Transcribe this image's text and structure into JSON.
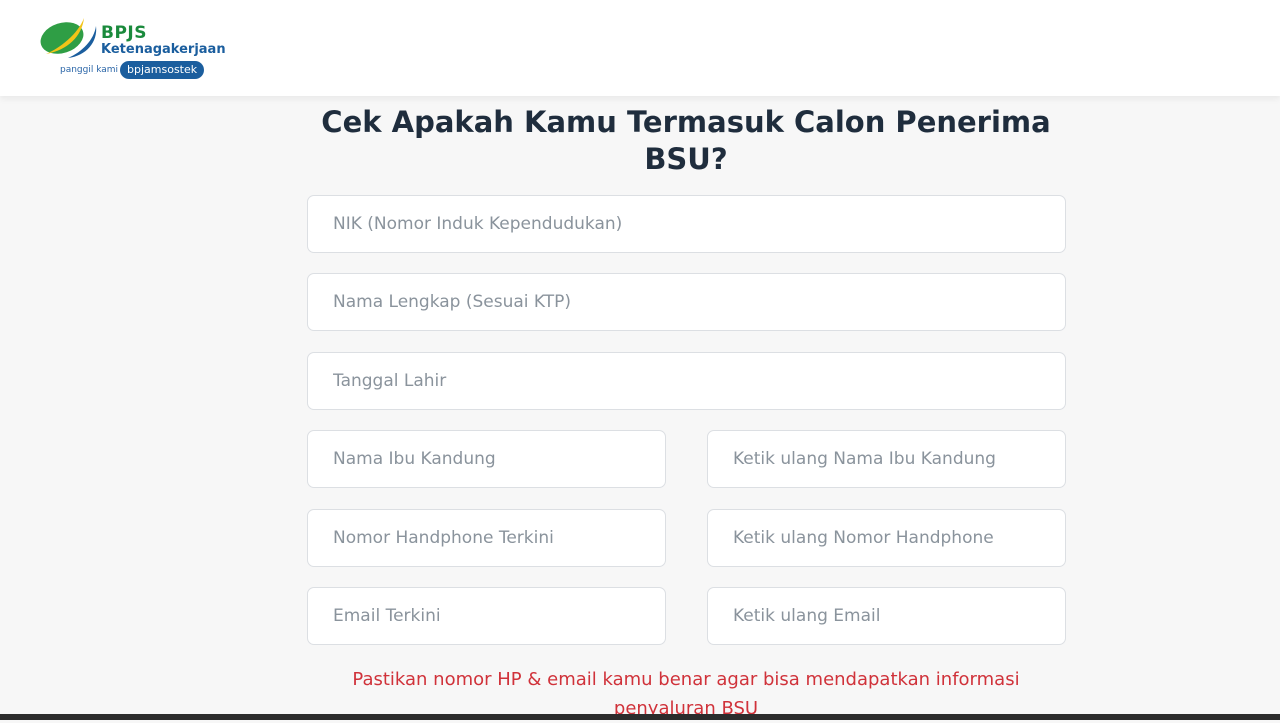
{
  "header": {
    "brand_name": "BPJS",
    "brand_sub": "Ketenagakerjaan",
    "tagline": "panggil kami",
    "tagline_pill": "bpjamsostek",
    "logo_icon": "bpjs-leaf-logo-icon",
    "colors": {
      "green": "#1a8a3c",
      "blue": "#1b5e9e",
      "yellow": "#f2c418"
    }
  },
  "main": {
    "title": "Cek Apakah Kamu Termasuk Calon Penerima BSU?",
    "fields": {
      "nik": {
        "placeholder": "NIK (Nomor Induk Kependudukan)",
        "value": ""
      },
      "nama_lengkap": {
        "placeholder": "Nama Lengkap (Sesuai KTP)",
        "value": ""
      },
      "tanggal_lahir": {
        "placeholder": "Tanggal Lahir",
        "value": ""
      },
      "nama_ibu": {
        "placeholder": "Nama Ibu Kandung",
        "value": ""
      },
      "nama_ibu_ulang": {
        "placeholder": "Ketik ulang Nama Ibu Kandung",
        "value": ""
      },
      "nomor_hp": {
        "placeholder": "Nomor Handphone Terkini",
        "value": ""
      },
      "nomor_hp_ulang": {
        "placeholder": "Ketik ulang Nomor Handphone",
        "value": ""
      },
      "email": {
        "placeholder": "Email Terkini",
        "value": ""
      },
      "email_ulang": {
        "placeholder": "Ketik ulang Email",
        "value": ""
      }
    },
    "warning_text": "Pastikan nomor HP & email kamu benar agar bisa mendapatkan informasi penyaluran BSU",
    "warning_color": "#d0323a"
  }
}
